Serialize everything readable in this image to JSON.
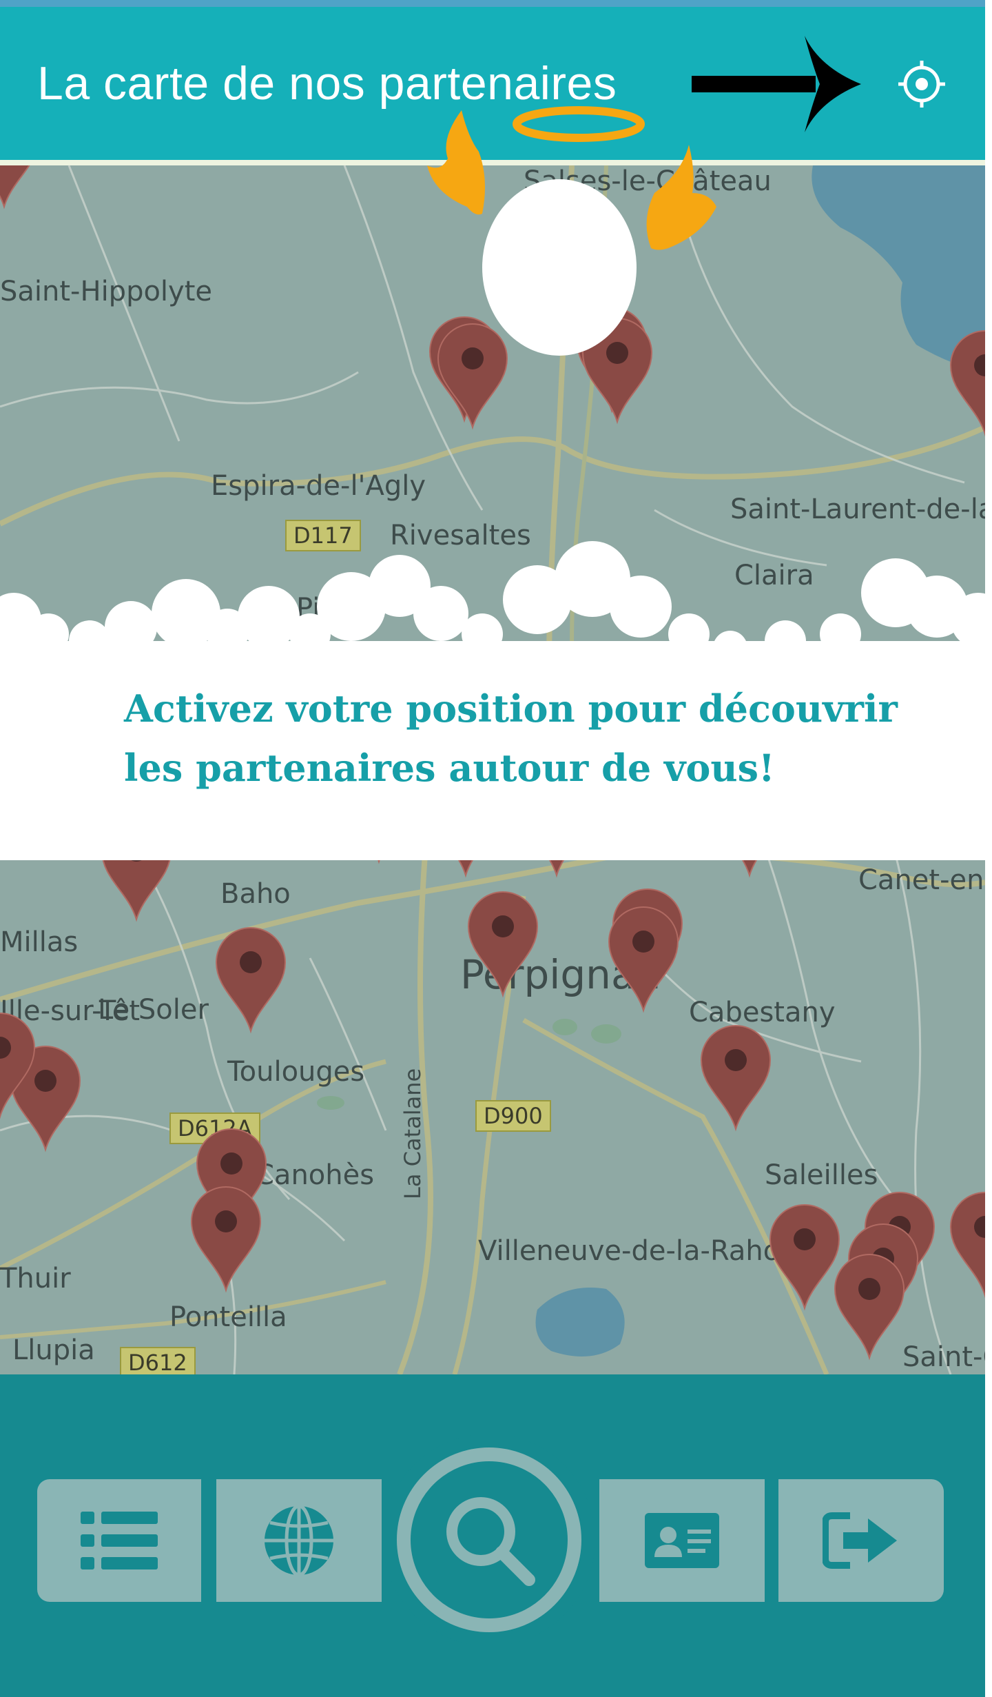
{
  "header": {
    "title": "La carte de nos partenaires",
    "locate_icon": "crosshair-icon",
    "background_color": "#15b0b9"
  },
  "message": {
    "text": "Activez votre position pour découvrir les partenaires autour de vous!"
  },
  "map": {
    "place_labels": [
      "Saint-Hippolyte",
      "Salses-le-Château",
      "Espira-de-l'Agly",
      "Rivesaltes",
      "Saint-Laurent-de-la-Salanque",
      "Claira",
      "Baho",
      "Millas",
      "Ille-sur-Têt",
      "Le Soler",
      "Perpignan",
      "Cabestany",
      "Canet-en-Roussillon",
      "Toulouges",
      "La Catalane",
      "Canohès",
      "Villeneuve-de-la-Raho",
      "Saleilles",
      "Thuir",
      "Ponteilla",
      "Llupia",
      "Saint-Cyprien",
      "Pia"
    ],
    "road_badges": [
      "D117",
      "D612A",
      "D900",
      "D612"
    ],
    "marker_color": "#8a4a45"
  },
  "nav": {
    "items": [
      {
        "name": "list",
        "icon": "list-icon"
      },
      {
        "name": "globe",
        "icon": "globe-icon"
      },
      {
        "name": "search",
        "icon": "search-icon"
      },
      {
        "name": "profile",
        "icon": "id-card-icon"
      },
      {
        "name": "logout",
        "icon": "sign-out-icon"
      }
    ],
    "bar_color": "#168a90",
    "button_color": "#8ab5b5"
  }
}
